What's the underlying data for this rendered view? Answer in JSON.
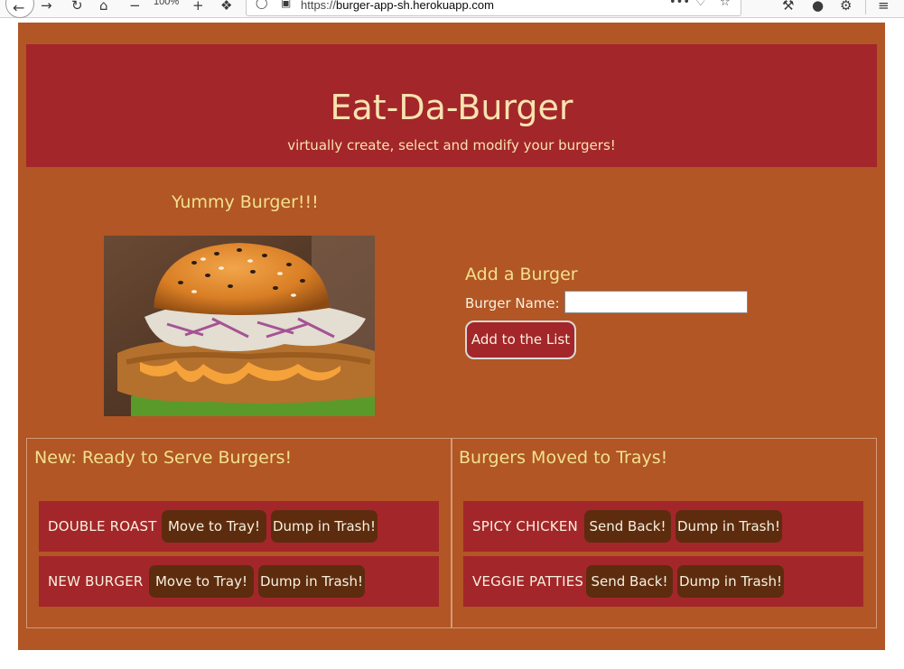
{
  "browser": {
    "zoom": "100%",
    "url_prefix": "https://",
    "url_host": "burger-app-sh.herokuapp.com"
  },
  "header": {
    "title": "Eat-Da-Burger",
    "subtitle": "virtually create, select and modify your burgers!"
  },
  "feature": {
    "heading": "Yummy Burger!!!"
  },
  "add_form": {
    "title": "Add a Burger",
    "name_label": "Burger Name:",
    "name_value": "",
    "submit_label": "Add to the List"
  },
  "new_panel": {
    "title": "New: Ready to Serve Burgers!",
    "burgers": [
      {
        "name": "DOUBLE ROAST",
        "action": "Move to Tray!",
        "trash": "Dump in Trash!"
      },
      {
        "name": "NEW BURGER",
        "action": "Move to Tray!",
        "trash": "Dump in Trash!"
      }
    ]
  },
  "tray_panel": {
    "title": "Burgers Moved to Trays!",
    "burgers": [
      {
        "name": "SPICY CHICKEN",
        "action": "Send Back!",
        "trash": "Dump in Trash!"
      },
      {
        "name": "VEGGIE PATTIES",
        "action": "Send Back!",
        "trash": "Dump in Trash!"
      }
    ]
  },
  "colors": {
    "page_bg": "#b15624",
    "header_bg": "#a3262a",
    "button_dark": "#5d2c0e",
    "accent_text": "#f2e08e"
  }
}
